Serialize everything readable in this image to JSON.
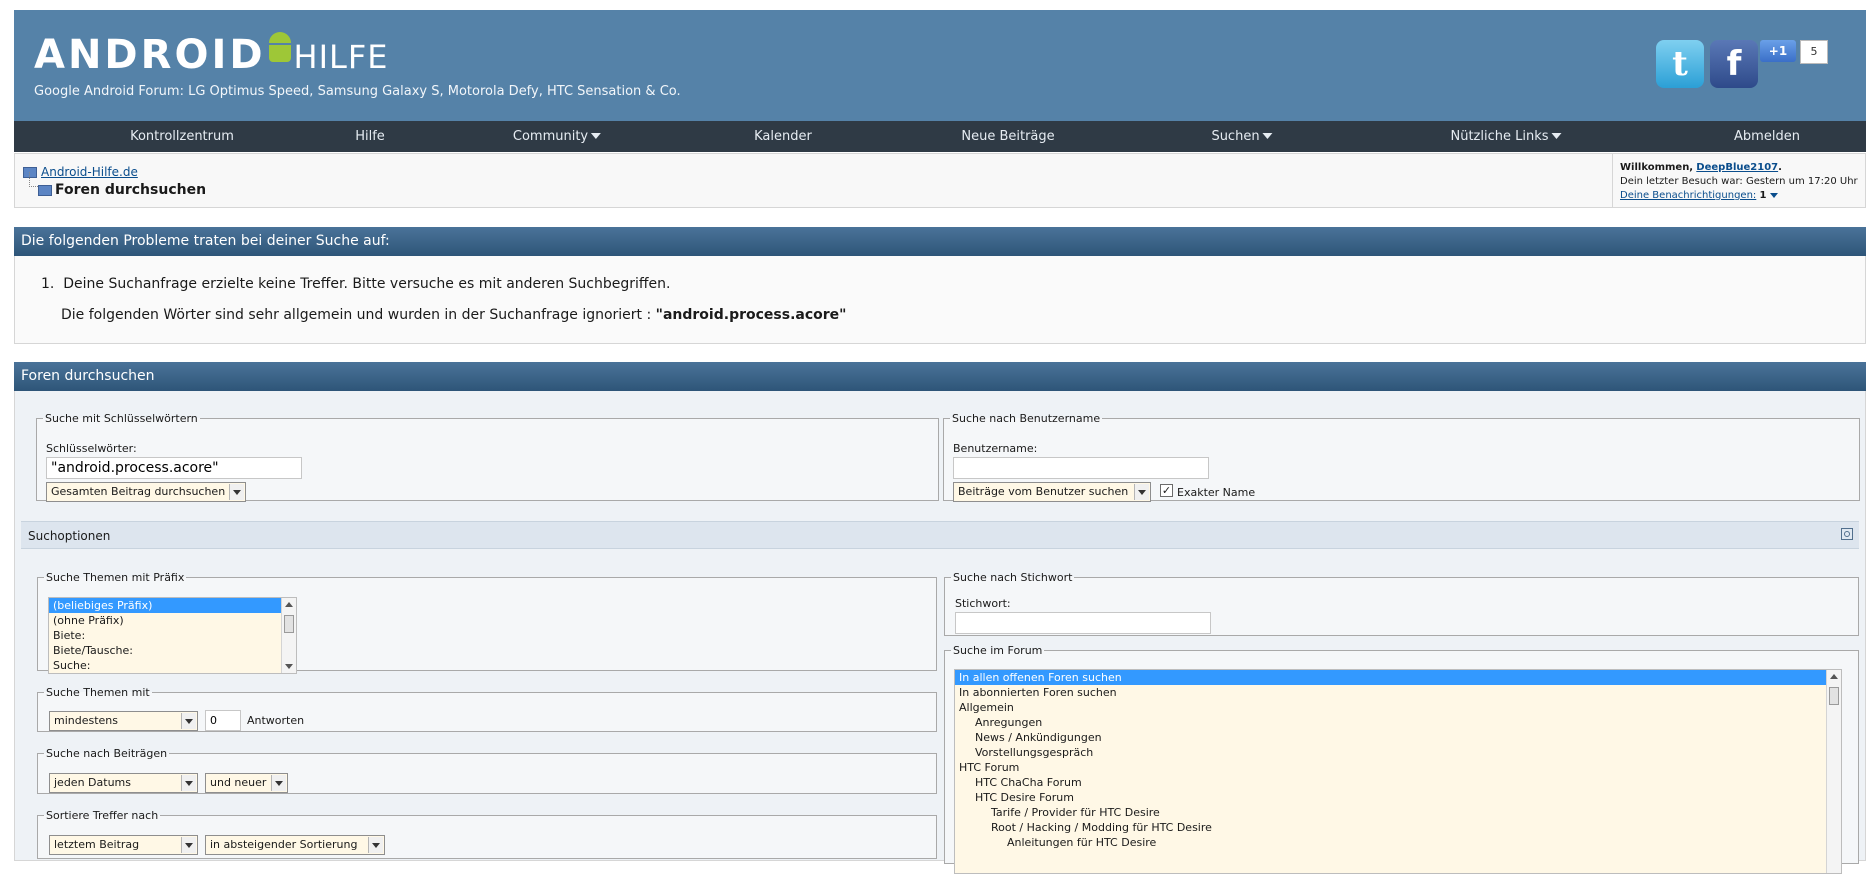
{
  "header": {
    "logo_text": "ANDROID",
    "logo_suffix": "HILFE",
    "tagline": "Google Android Forum: LG Optimus Speed, Samsung Galaxy S, Motorola Defy, HTC Sensation & Co.",
    "twitter_glyph": "t",
    "facebook_glyph": "f",
    "gplus_label": "+1",
    "gplus_count": "5"
  },
  "nav": {
    "items": [
      "Kontrollzentrum",
      "Hilfe",
      "Community",
      "Kalender",
      "Neue Beiträge",
      "Suchen",
      "Nützliche Links",
      "Abmelden"
    ]
  },
  "breadcrumb": {
    "home": "Android-Hilfe.de",
    "current": "Foren durchsuchen"
  },
  "welcome": {
    "prefix": "Willkommen,",
    "user": "DeepBlue2107",
    "last_visit": "Dein letzter Besuch war: Gestern um 17:20 Uhr",
    "notifications_label": "Deine Benachrichtigungen:",
    "notifications_count": "1"
  },
  "errors": {
    "title": "Die folgenden Probleme traten bei deiner Suche auf:",
    "number": "1.",
    "line1": "Deine Suchanfrage erzielte keine Treffer. Bitte versuche es mit anderen Suchbegriffen.",
    "line2": "Die folgenden Wörter sind sehr allgemein und wurden in der Suchanfrage ignoriert :",
    "ignored": "\"android.process.acore\""
  },
  "search": {
    "title": "Foren durchsuchen",
    "keywords": {
      "legend": "Suche mit Schlüsselwörtern",
      "label": "Schlüsselwörter:",
      "value": "\"android.process.acore\"",
      "scope": "Gesamten Beitrag durchsuchen"
    },
    "username": {
      "legend": "Suche nach Benutzername",
      "label": "Benutzername:",
      "value": "",
      "scope": "Beiträge vom Benutzer suchen",
      "exact_label": "Exakter Name",
      "exact_checked": true
    },
    "options_title": "Suchoptionen",
    "prefix": {
      "legend": "Suche Themen mit Präfix",
      "options": [
        "(beliebiges Präfix)",
        "(ohne Präfix)",
        "Biete:",
        "Biete/Tausche:",
        "Suche:"
      ]
    },
    "replies": {
      "legend": "Suche Themen mit",
      "mode": "mindestens",
      "count": "0",
      "suffix": "Antworten"
    },
    "posts": {
      "legend": "Suche nach Beiträgen",
      "date": "jeden Datums",
      "direction": "und neuer"
    },
    "sort": {
      "legend": "Sortiere Treffer nach",
      "field": "letztem Beitrag",
      "order": "in absteigender Sortierung"
    },
    "tag": {
      "legend": "Suche nach Stichwort",
      "label": "Stichwort:",
      "value": ""
    },
    "forum": {
      "legend": "Suche im Forum",
      "options": [
        {
          "label": "In allen offenen Foren suchen",
          "level": 0
        },
        {
          "label": "In abonnierten Foren suchen",
          "level": 0
        },
        {
          "label": "Allgemein",
          "level": 0
        },
        {
          "label": "Anregungen",
          "level": 1
        },
        {
          "label": "News / Ankündigungen",
          "level": 1
        },
        {
          "label": "Vorstellungsgespräch",
          "level": 1
        },
        {
          "label": "HTC Forum",
          "level": 0
        },
        {
          "label": "HTC ChaCha Forum",
          "level": 1
        },
        {
          "label": "HTC Desire Forum",
          "level": 1
        },
        {
          "label": "Tarife / Provider für HTC Desire",
          "level": 2
        },
        {
          "label": "Root / Hacking / Modding für HTC Desire",
          "level": 2
        },
        {
          "label": "Anleitungen für HTC Desire",
          "level": 3
        }
      ]
    }
  }
}
